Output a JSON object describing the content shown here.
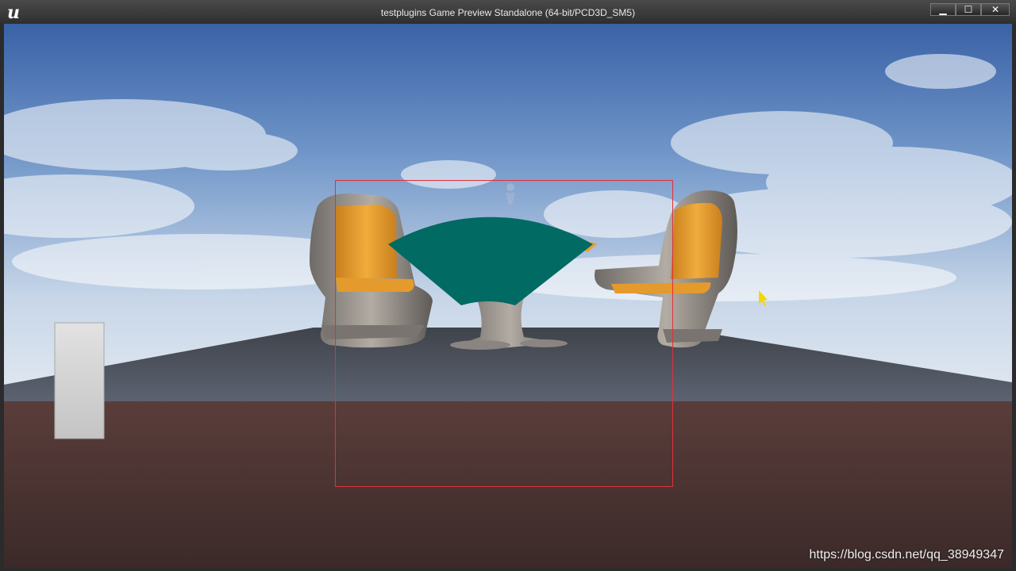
{
  "window": {
    "title": "testplugins Game Preview Standalone (64-bit/PCD3D_SM5)",
    "logo_text": "u",
    "logo_icon": "unreal-engine-logo-icon",
    "buttons": {
      "minimize_icon": "minimize-icon",
      "maximize_icon": "maximize-icon",
      "close_icon": "close-icon",
      "minimize_glyph": "▁",
      "maximize_glyph": "☐",
      "close_glyph": "✕"
    }
  },
  "scene": {
    "sky_color_top": "#3c66a8",
    "sky_color_horizon": "#cfdbea",
    "platform_color": "#4a4f58",
    "ground_color": "#4a3230",
    "cushion_color": "#e8a030",
    "chair_frame_color": "#8a8580",
    "fan_widget_color": "#006a63",
    "selection_box_color": "#e0303a",
    "cursor_color": "#f2d800",
    "side_panel_color": "#d6d6d6"
  },
  "watermark": {
    "text": "https://blog.csdn.net/qq_38949347"
  }
}
